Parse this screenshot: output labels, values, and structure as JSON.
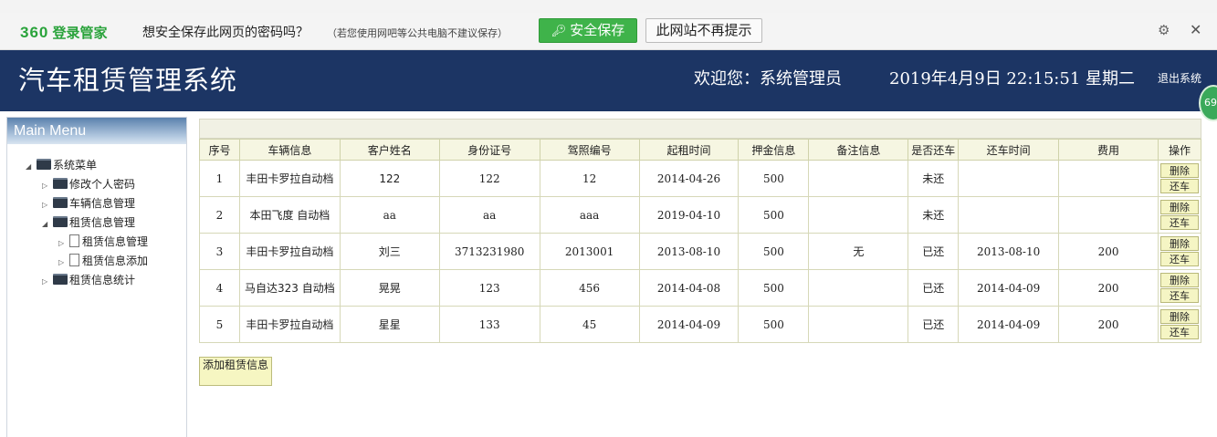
{
  "password_bar": {
    "logo_num": "360",
    "logo_text": "登录管家",
    "question": "想安全保存此网页的密码吗？",
    "note": "（若您使用网吧等公共电脑不建议保存）",
    "save_label": "安全保存",
    "never_label": "此网站不再提示"
  },
  "header": {
    "title": "汽车租赁管理系统",
    "welcome": "欢迎您：系统管理员",
    "datetime": "2019年4月9日 22:15:51 星期二",
    "logout": "退出系统",
    "badge": "69"
  },
  "sidebar": {
    "heading": "Main Menu",
    "root": "系统菜单",
    "items": [
      {
        "label": "修改个人密码"
      },
      {
        "label": "车辆信息管理"
      },
      {
        "label": "租赁信息管理"
      },
      {
        "label": "租赁信息管理"
      },
      {
        "label": "租赁信息添加"
      },
      {
        "label": "租赁信息统计"
      }
    ]
  },
  "table": {
    "columns": [
      "序号",
      "车辆信息",
      "客户姓名",
      "身份证号",
      "驾照编号",
      "起租时间",
      "押金信息",
      "备注信息",
      "是否还车",
      "还车时间",
      "费用",
      "操作"
    ],
    "rows": [
      [
        "1",
        "丰田卡罗拉自动档",
        "122",
        "122",
        "12",
        "2014-04-26",
        "500",
        "",
        "未还",
        "",
        ""
      ],
      [
        "2",
        "本田飞度 自动档",
        "aa",
        "aa",
        "aaa",
        "2019-04-10",
        "500",
        "",
        "未还",
        "",
        ""
      ],
      [
        "3",
        "丰田卡罗拉自动档",
        "刘三",
        "3713231980",
        "2013001",
        "2013-08-10",
        "500",
        "无",
        "已还",
        "2013-08-10",
        "200"
      ],
      [
        "4",
        "马自达323 自动档",
        "晃晃",
        "123",
        "456",
        "2014-04-08",
        "500",
        "",
        "已还",
        "2014-04-09",
        "200"
      ],
      [
        "5",
        "丰田卡罗拉自动档",
        "星星",
        "133",
        "45",
        "2014-04-09",
        "500",
        "",
        "已还",
        "2014-04-09",
        "200"
      ]
    ],
    "delete_label": "删除",
    "return_label": "还车"
  },
  "add_button": "添加租赁信息"
}
